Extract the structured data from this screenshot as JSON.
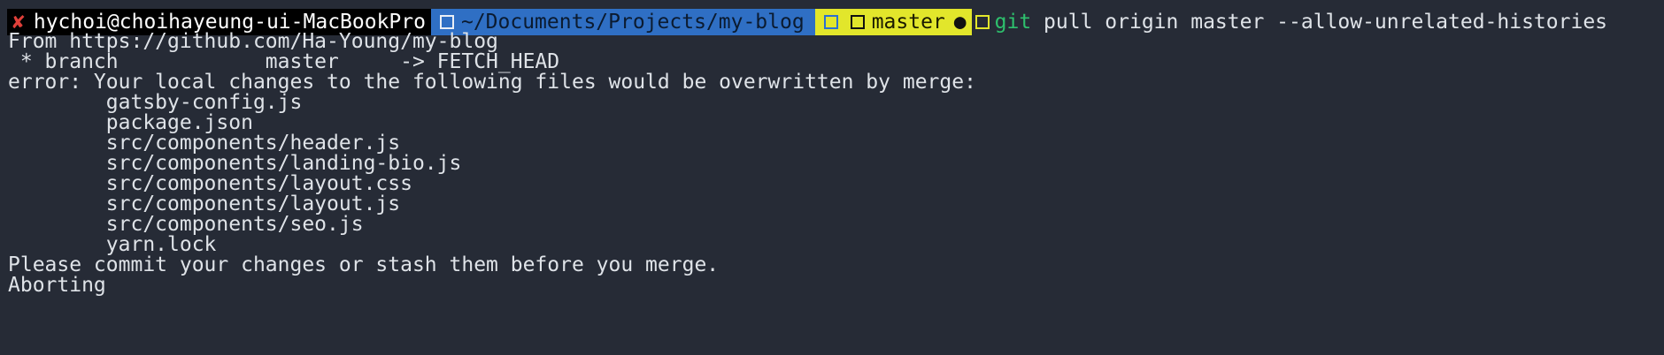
{
  "prompt": {
    "status_icon": "cross-icon",
    "status_color": "#e0403a",
    "user_host": "hychoi@choihayeung-ui-MacBookPro",
    "cwd": "~/Documents/Projects/my-blog",
    "branch": "master",
    "dirty_marker": "●",
    "command_name": "git",
    "command_args": " pull origin master --allow-unrelated-histories",
    "colors": {
      "dir_segment": "#2f6fc4",
      "git_segment": "#e2e62b",
      "status_segment": "#000000",
      "command": "#2ec06d",
      "background": "#262b36"
    }
  },
  "output": {
    "lines": [
      "From https://github.com/Ha-Young/my-blog",
      " * branch            master     -> FETCH_HEAD",
      "error: Your local changes to the following files would be overwritten by merge:",
      "        gatsby-config.js",
      "        package.json",
      "        src/components/header.js",
      "        src/components/landing-bio.js",
      "        src/components/layout.css",
      "        src/components/layout.js",
      "        src/components/seo.js",
      "        yarn.lock",
      "Please commit your changes or stash them before you merge.",
      "Aborting"
    ]
  }
}
